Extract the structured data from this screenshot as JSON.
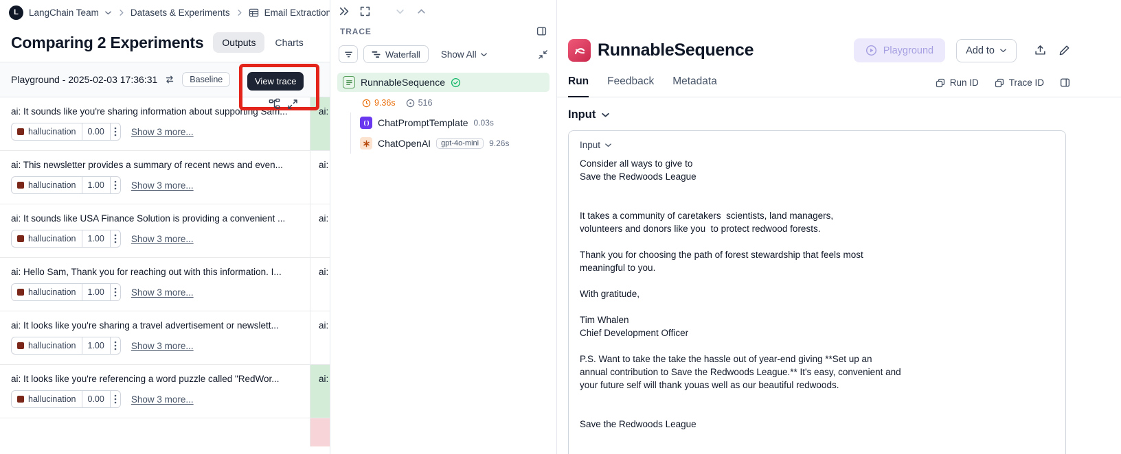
{
  "colors": {
    "annotation_red": "#e3241b",
    "selected_trace_green": "#e4f4e8",
    "cell_pass_green": "#d3ecd8",
    "cell_fail_pink": "#f6d4d7",
    "duration_orange": "#ea700d",
    "playground_button_bg": "#ebe9fb",
    "hallucination_icon": "#7a271a"
  },
  "breadcrumb": {
    "logo_letter": "L",
    "team": "LangChain Team",
    "items": [
      "Datasets & Experiments",
      "Email Extraction"
    ]
  },
  "page": {
    "title": "Comparing 2 Experiments",
    "tabs": [
      {
        "label": "Outputs"
      },
      {
        "label": "Charts"
      }
    ]
  },
  "table": {
    "header": {
      "column_title": "Playground - 2025-02-03 17:36:31",
      "baseline_badge": "Baseline"
    },
    "annotation": {
      "tooltip": "View trace"
    },
    "rows": [
      {
        "text": "ai: It sounds like you're sharing information about supporting Sam...",
        "metric": "hallucination",
        "score": "0.00",
        "more": "Show 3 more...",
        "peer": "ai:"
      },
      {
        "text": "ai: This newsletter provides a summary of recent news and even...",
        "metric": "hallucination",
        "score": "1.00",
        "more": "Show 3 more...",
        "peer": "ai:"
      },
      {
        "text": "ai: It sounds like USA Finance Solution is providing a convenient ...",
        "metric": "hallucination",
        "score": "1.00",
        "more": "Show 3 more...",
        "peer": "ai:"
      },
      {
        "text": "ai: Hello Sam, Thank you for reaching out with this information. I...",
        "metric": "hallucination",
        "score": "1.00",
        "more": "Show 3 more...",
        "peer": "ai:"
      },
      {
        "text": "ai: It looks like you're sharing a travel advertisement or newslett...",
        "metric": "hallucination",
        "score": "1.00",
        "more": "Show 3 more...",
        "peer": "ai:"
      },
      {
        "text": "ai: It looks like you're referencing a word puzzle called \"RedWor...",
        "metric": "hallucination",
        "score": "0.00",
        "more": "Show 3 more...",
        "peer": "ai:"
      },
      {
        "text": "",
        "peer": ""
      }
    ]
  },
  "trace": {
    "panel_label": "TRACE",
    "toolbar": {
      "waterfall": "Waterfall",
      "show_all": "Show All"
    },
    "root": {
      "name": "RunnableSequence",
      "duration": "9.36s",
      "tokens": "516"
    },
    "children": [
      {
        "name": "ChatPromptTemplate",
        "duration": "0.03s"
      },
      {
        "name": "ChatOpenAI",
        "model": "gpt-4o-mini",
        "duration": "9.26s"
      }
    ]
  },
  "detail": {
    "title": "RunnableSequence",
    "actions": {
      "playground": "Playground",
      "add_to": "Add to"
    },
    "tabs": [
      {
        "label": "Run"
      },
      {
        "label": "Feedback"
      },
      {
        "label": "Metadata"
      }
    ],
    "ids": {
      "run_id": "Run ID",
      "trace_id": "Trace ID"
    },
    "input_section": {
      "heading": "Input",
      "selector": "Input",
      "text": "Consider all ways to give to\nSave the Redwoods League\n\n\nIt takes a community of caretakers  scientists, land managers,\nvolunteers and donors like you  to protect redwood forests.\n\nThank you for choosing the path of forest stewardship that feels most\nmeaningful to you.\n\nWith gratitude,\n\nTim Whalen\nChief Development Officer\n\nP.S. Want to take the take the hassle out of year-end giving **Set up an\nannual contribution to Save the Redwoods League.** It's easy, convenient and\nyour future self will thank youas well as our beautiful redwoods.\n\n\nSave the Redwoods League"
    }
  }
}
